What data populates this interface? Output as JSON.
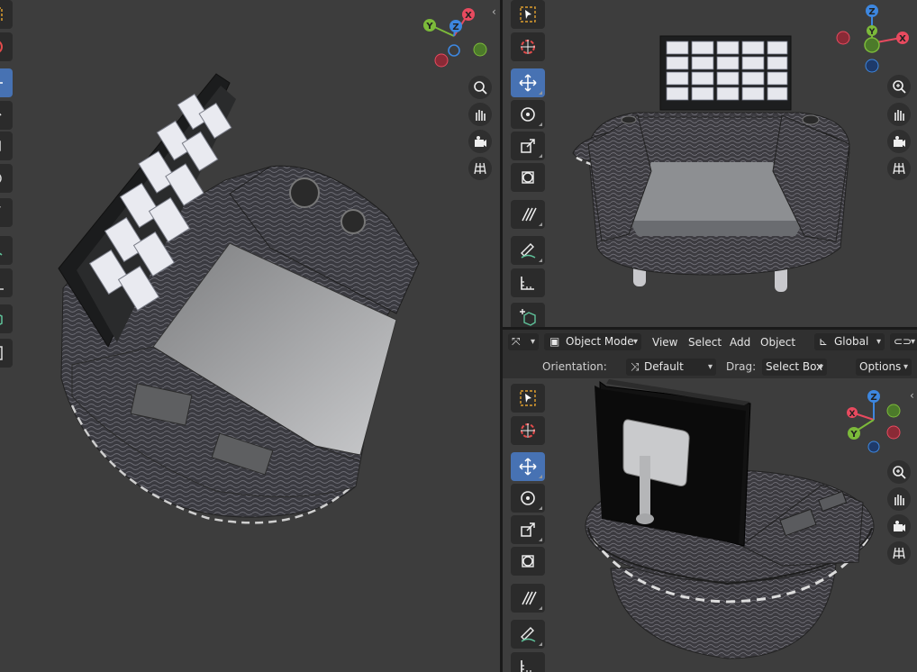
{
  "app": "Blender 3D Viewport",
  "gizmo_axes": {
    "x": "X",
    "y": "Y",
    "z": "Z"
  },
  "colors": {
    "x_axis": "#e84a5f",
    "y_axis": "#7cba3a",
    "z_axis": "#3d87e0",
    "active_tool": "#4772b3",
    "viewport_bg": "#3d3d3d"
  },
  "left_toolbar_icons": [
    "select-box-icon",
    "cursor-icon",
    "move-icon",
    "rotate-icon",
    "scale-icon",
    "transform-icon",
    "annotate-icon",
    "measure-icon",
    "add-cube-icon",
    "extra-icon"
  ],
  "toolbar_icons": [
    "select-box-icon",
    "cursor-icon",
    "move-icon",
    "rotate-icon",
    "scale-icon",
    "transform-icon",
    "annotate-icon",
    "draw-icon",
    "measure-icon",
    "add-cube-icon"
  ],
  "nav_icons": [
    "zoom-icon",
    "hand-pan-icon",
    "camera-icon",
    "grid-perspective-icon"
  ],
  "header": {
    "mode": "Object Mode",
    "menu": [
      "View",
      "Select",
      "Add",
      "Object"
    ],
    "transform_space": "Global"
  },
  "tool_settings": {
    "orientation_label": "Orientation:",
    "orientation_value": "Default",
    "drag_label": "Drag:",
    "drag_value": "Select Box",
    "options_label": "Options"
  }
}
